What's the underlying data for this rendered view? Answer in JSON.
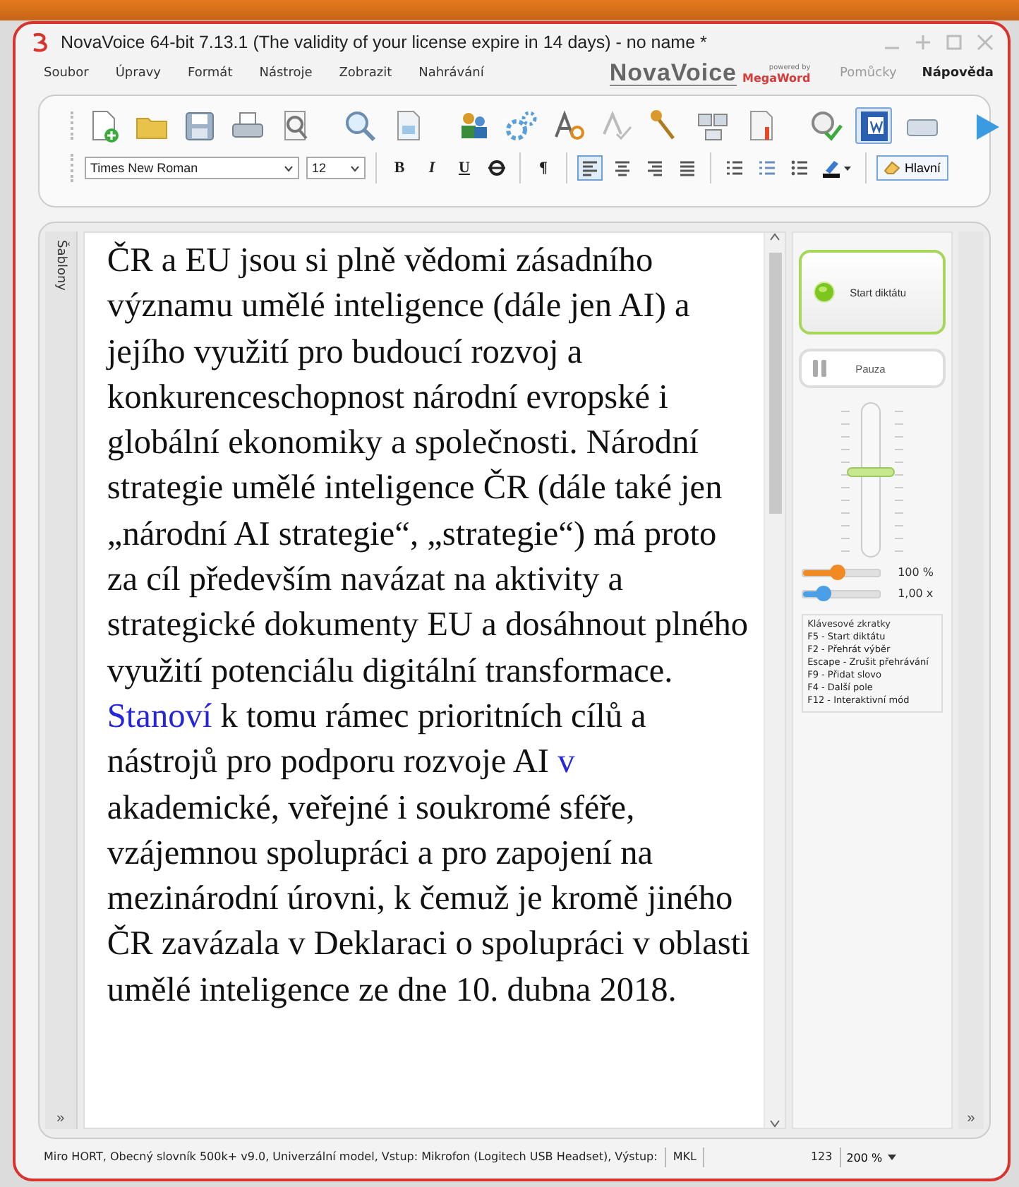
{
  "window": {
    "title": "NovaVoice 64-bit 7.13.1 (The validity of your license expire in 14 days) - no name *"
  },
  "menu": [
    "Soubor",
    "Úpravy",
    "Formát",
    "Nástroje",
    "Zobrazit",
    "Nahrávání"
  ],
  "brand": {
    "name": "NovaVoice",
    "tagline": "powered by",
    "partner": "MegaWord"
  },
  "menu_right": [
    "Pomůcky",
    "Nápověda"
  ],
  "format_bar": {
    "font": "Times New Roman",
    "size": "12",
    "style_buttons": [
      {
        "label": "B",
        "kind": "bold"
      },
      {
        "label": "I",
        "kind": "italic"
      },
      {
        "label": "U",
        "kind": "underline"
      }
    ],
    "paragraph_mark": "¶",
    "alignment": [
      {
        "selected": true
      },
      {
        "selected": false
      },
      {
        "selected": false
      },
      {
        "selected": false
      }
    ],
    "style": {
      "label": "Hlavní",
      "selected": true
    }
  },
  "side_tab": {
    "label": "Šablony",
    "expand": "»"
  },
  "document": {
    "segments": [
      {
        "text": "ČR a EU jsou si plně vědomi zásadního významu umělé inteligence (dále jen AI) a jejího využití pro budoucí rozvoj a konkurenceschopnost národní evropské i globální ekonomiky a společnosti. Národní strategie umělé inteligence ČR (dále také jen „národní AI strategie“, „strategie“) má proto za cíl především navázat na aktivity a strategické dokumenty EU a dosáhnout plného využití potenciálu digitální transformace. ",
        "kind": "plain"
      },
      {
        "text": "Stanoví",
        "kind": "highlight"
      },
      {
        "text": " k tomu rámec prioritních cílů a nástrojů pro podporu rozvoje AI ",
        "kind": "plain"
      },
      {
        "text": "v",
        "kind": "highlight"
      },
      {
        "text": " akademické, veřejné i soukromé sféře, vzájemnou spolupráci a pro zapojení na mezinárodní úrovni, k čemuž je kromě jiného ČR zavázala v Deklaraci o spolupráci v oblasti umělé inteligence ze dne 10. dubna 2018.",
        "kind": "plain"
      }
    ]
  },
  "dictation": {
    "start": {
      "label": "Start diktátu"
    },
    "pause": {
      "label": "Pauza"
    },
    "volume": {
      "level": 0.55
    },
    "sliders": [
      {
        "level": 0.45,
        "reading": "100 %",
        "color": "#f28a24"
      },
      {
        "level": 0.25,
        "reading": "1,00 x",
        "color": "#4b9fe6"
      }
    ],
    "shortcuts": {
      "title": "Klávesové zkratky",
      "items": [
        "F5 - Start diktátu",
        "F2 - Přehrát výběr",
        "Escape - Zrušit přehrávání",
        "F9 - Přidat slovo",
        "F4 - Další pole",
        "F12 - Interaktivní mód"
      ]
    }
  },
  "right_strip": {
    "expand": "»"
  },
  "status_bar": {
    "info": "Miro HORT, Obecný slovník 500k+ v9.0, Univerzální model, Vstup: Mikrofon (Logitech USB Headset), Výstup:",
    "mode": "MKL",
    "count": "123",
    "zoom": "200 %"
  }
}
